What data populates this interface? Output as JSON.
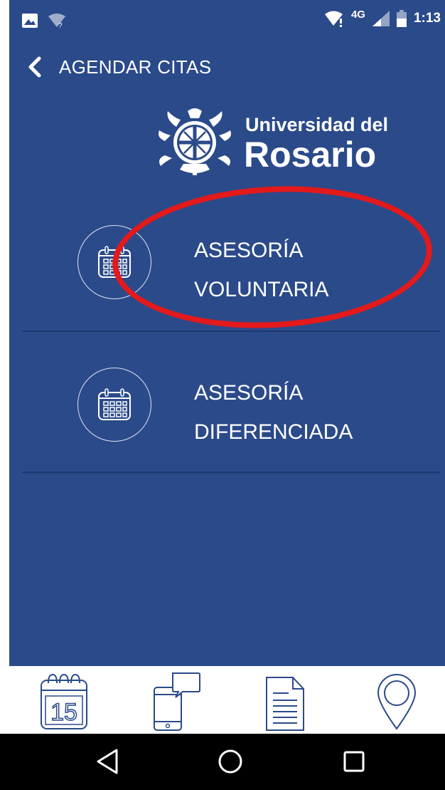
{
  "status_bar": {
    "network": "4G",
    "time": "1:13"
  },
  "header": {
    "title": "AGENDAR CITAS"
  },
  "logo": {
    "line1": "Universidad del",
    "line2": "Rosario"
  },
  "options": [
    {
      "line1": "ASESORÍA",
      "line2": "VOLUNTARIA"
    },
    {
      "line1": "ASESORÍA",
      "line2": "DIFERENCIADA"
    }
  ],
  "tab_bar": {
    "calendar_day": "15",
    "icons": [
      "calendar-icon",
      "phone-chat-icon",
      "document-icon",
      "location-pin-icon"
    ]
  },
  "nav_bar": {
    "icons": [
      "back-triangle-icon",
      "home-circle-icon",
      "recents-square-icon"
    ]
  },
  "colors": {
    "app_background": "#2b4a8a",
    "divider": "#1e3870",
    "highlight": "#e3191b",
    "tab_icon": "#2b4a8a"
  }
}
